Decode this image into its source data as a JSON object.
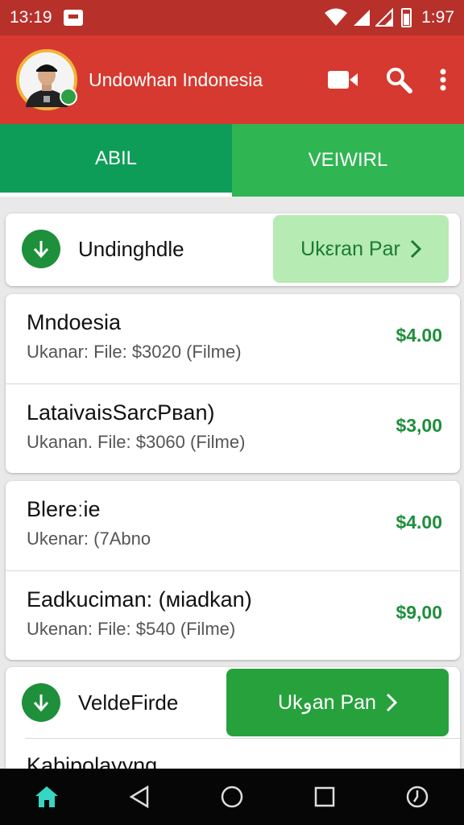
{
  "status": {
    "time": "13:19",
    "battery": "1:97"
  },
  "app_bar": {
    "title": "Undowhan Indonesia"
  },
  "tabs": [
    {
      "label": "ABIL"
    },
    {
      "label": "VEIWIRL"
    }
  ],
  "sections": [
    {
      "name": "Undinghdle",
      "button": "Ukεran Par",
      "items": [
        {
          "title": "Mndoesia",
          "subtitle": "Ukanar: File: $3020 (Filme)",
          "price": "$4.00"
        },
        {
          "title": "LataivaisSarcPвan)",
          "subtitle": "Ukanan. File: $3060 (Filme)",
          "price": "$3,00"
        }
      ]
    },
    {
      "items": [
        {
          "title": "Blereːie",
          "subtitle": "Ukenar: (7Abno",
          "price": "$4.00"
        },
        {
          "title": "Eadkuciman: (мiadkan)",
          "subtitle": "Ukenan: File: $540 (Filme)",
          "price": "$9,00"
        }
      ]
    },
    {
      "name": "VeldeFirde",
      "button": "Ukوan Pan",
      "items": [
        {
          "title": "Kabipolayyng"
        }
      ]
    }
  ],
  "colors": {
    "status_bar": "#b7302a",
    "app_bar": "#d6392f",
    "tab_active": "#0e9d58",
    "tab_inactive": "#2fb552",
    "price": "#1e8f3b",
    "button_light": "#b6ebb4",
    "button_dark": "#27a13c",
    "nav_bar": "#060606",
    "home_icon": "#35d6c4"
  },
  "icons": {
    "app_bar": [
      "video-camera-icon",
      "search-icon",
      "more-vert-icon"
    ],
    "nav": [
      "home-icon",
      "back-icon",
      "home-circle-icon",
      "recents-icon",
      "power-icon"
    ],
    "section": "download-arrow-icon"
  }
}
